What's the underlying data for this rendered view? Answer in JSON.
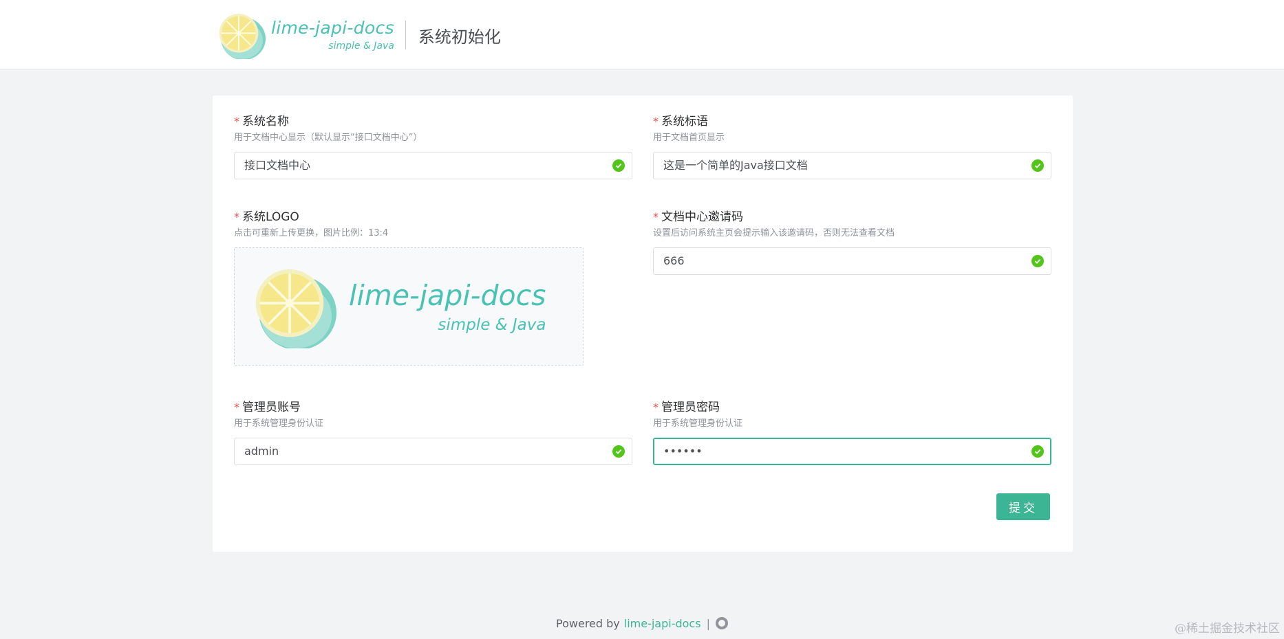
{
  "header": {
    "logo_name": "lime-japi-docs",
    "logo_sub": "simple & Java",
    "page_title": "系统初始化"
  },
  "form": {
    "required_mark": "*",
    "system_name": {
      "label": "系统名称",
      "hint": "用于文档中心显示（默认显示“接口文档中心”）",
      "value": "接口文档中心"
    },
    "system_slogan": {
      "label": "系统标语",
      "hint": "用于文档首页显示",
      "value": "这是一个简单的Java接口文档"
    },
    "system_logo": {
      "label": "系统LOGO",
      "hint": "点击可重新上传更换，图片比例：13:4",
      "logo_name": "lime-japi-docs",
      "logo_sub": "simple & Java"
    },
    "invite_code": {
      "label": "文档中心邀请码",
      "hint": "设置后访问系统主页会提示输入该邀请码，否则无法查看文档",
      "value": "666"
    },
    "admin_account": {
      "label": "管理员账号",
      "hint": "用于系统管理身份认证",
      "value": "admin"
    },
    "admin_password": {
      "label": "管理员密码",
      "hint": "用于系统管理身份认证",
      "value": "••••••"
    },
    "submit_label": "提交"
  },
  "footer": {
    "powered_by": "Powered by",
    "brand": "lime-japi-docs",
    "separator": "|"
  },
  "watermark": "@稀土掘金技术社区",
  "colors": {
    "accent": "#3cb595",
    "brand_teal": "#48c2b3",
    "success": "#52c41a",
    "required": "#e05252"
  }
}
